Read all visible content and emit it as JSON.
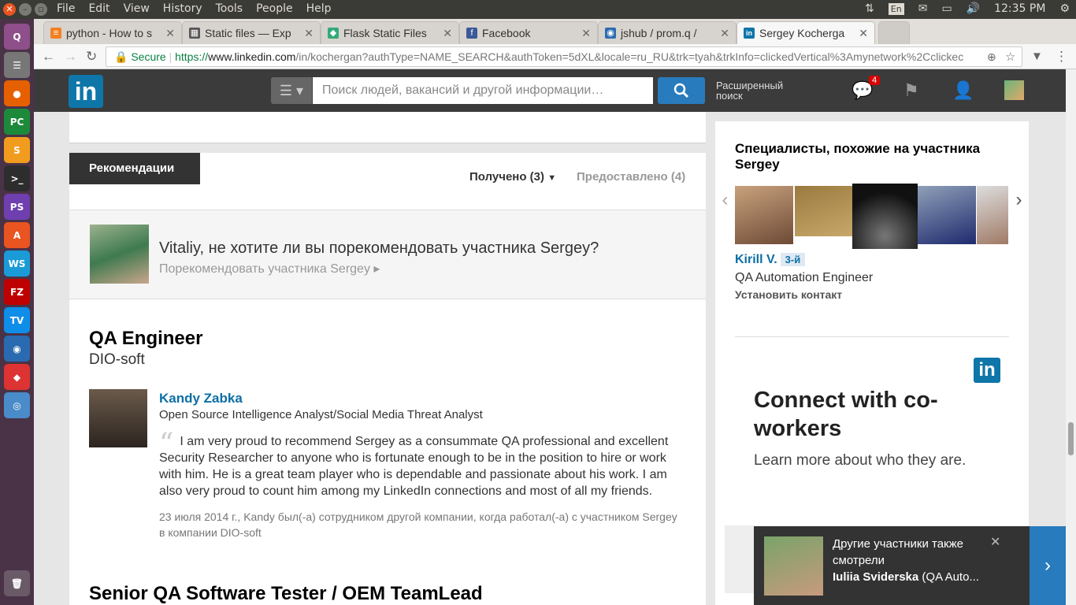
{
  "system": {
    "menus": [
      "File",
      "Edit",
      "View",
      "History",
      "Tools",
      "People",
      "Help"
    ],
    "lang": "En",
    "time": "12:35 PM"
  },
  "launcher": [
    "Q",
    "☰",
    "●",
    "PC",
    "S",
    ">_",
    "PS",
    "A",
    "WS",
    "FZ",
    "TV",
    "◉",
    "◆",
    "◎",
    "🗑"
  ],
  "tabs": [
    {
      "title": "python - How to s",
      "icon_color": "#f48024",
      "icon": "≡"
    },
    {
      "title": "Static files — Exp",
      "icon_color": "#555",
      "icon": "▦"
    },
    {
      "title": "Flask Static Files",
      "icon_color": "#3a7",
      "icon": "◆"
    },
    {
      "title": "Facebook",
      "icon_color": "#3b5998",
      "icon": "f"
    },
    {
      "title": "jshub / prom.q / ",
      "icon_color": "#2b6cb0",
      "icon": "◉"
    },
    {
      "title": "Sergey Kocherga",
      "icon_color": "#0e76a8",
      "icon": "in"
    }
  ],
  "address": {
    "secure_label": "Secure",
    "scheme": "https://",
    "host": "www.linkedin.com",
    "rest": "/in/kochergan?authType=NAME_SEARCH&authToken=5dXL&locale=ru_RU&trk=tyah&trkInfo=clickedVertical%3Amynetwork%2Cclickec"
  },
  "header": {
    "logo": "in",
    "search_placeholder": "Поиск людей, вакансий и другой информации…",
    "advanced_line1": "Расширенный",
    "advanced_line2": "поиск",
    "messages_badge": "4"
  },
  "recommendations": {
    "tab_label": "Рекомендации",
    "received_label": "Получено (3)",
    "given_label": "Предоставлено (4)",
    "prompt_title": "Vitaliy, не хотите ли вы порекомендовать участника Sergey?",
    "prompt_link": "Порекомендовать участника Sergey ▸",
    "job_title": "QA Engineer",
    "job_company": "DIO-soft",
    "recommender_name": "Kandy Zabka",
    "recommender_role": "Open Source Intelligence Analyst/Social Media Threat Analyst",
    "recommendation_text": "I am very proud to recommend Sergey as a consummate QA professional and excellent Security Researcher to anyone who is fortunate enough to be in the position to hire or work with him. He is a great team player who is dependable and passionate about his work. I am also very proud to count him among my LinkedIn connections and most of all my friends.",
    "recommendation_date": "23 июля 2014 г., Kandy был(-а) сотрудником другой компании, когда работал(-а) с участником Sergey в компании DIO-soft",
    "job2_title": "Senior QA Software Tester / OEM TeamLead"
  },
  "sidebar": {
    "title": "Специалисты, похожие на участника Sergey",
    "person_name": "Kirill V.",
    "person_degree": "3-й",
    "person_role": "QA Automation Engineer",
    "connect_label": "Установить контакт",
    "ad_logo": "in",
    "ad_title": "Connect with co-workers",
    "ad_subtitle": "Learn more about who they are."
  },
  "popup": {
    "line1": "Другие участники также смотрели",
    "name": "Iuliia Sviderska",
    "role": " (QA Auto...",
    "close": "✕",
    "next": "›"
  }
}
